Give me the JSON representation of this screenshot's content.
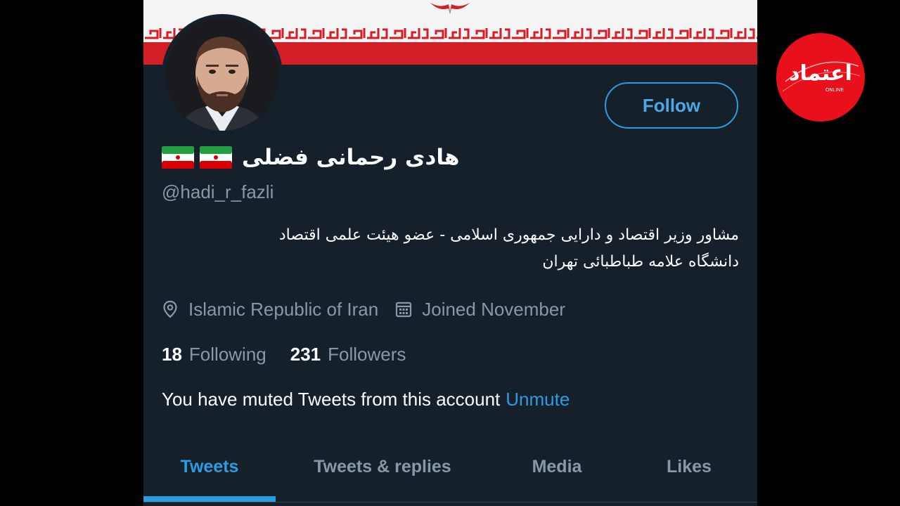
{
  "profile": {
    "display_name": "هادی رحمانی فضلی",
    "handle": "@hadi_r_fazli",
    "bio_lines": [
      "مشاور وزیر اقتصاد و دارایی جمهوری اسلامی - عضو هیئت علمی اقتصاد",
      "دانشگاه علامه طباطبائی تهران"
    ],
    "location": "Islamic Republic of Iran",
    "joined": "Joined November",
    "following_count": "18",
    "following_label": "Following",
    "followers_count": "231",
    "followers_label": "Followers",
    "location_icon": "location-pin-icon",
    "calendar_icon": "calendar-icon",
    "name_flags": [
      "iran-flag-icon",
      "iran-flag-icon"
    ]
  },
  "actions": {
    "follow_label": "Follow"
  },
  "muted_notice": {
    "text": "You have muted Tweets from this account",
    "action_label": "Unmute"
  },
  "tabs": [
    {
      "label": "Tweets",
      "active": true
    },
    {
      "label": "Tweets & replies",
      "active": false
    },
    {
      "label": "Media",
      "active": false
    },
    {
      "label": "Likes",
      "active": false
    }
  ],
  "watermark": {
    "logo_text": "اعتماد",
    "logo_subtext": "ONLINE"
  },
  "colors": {
    "background": "#15202b",
    "accent": "#2b9de0",
    "secondary_text": "#8899a6",
    "banner_red": "#d21e26",
    "logo_red": "#e8101a"
  }
}
